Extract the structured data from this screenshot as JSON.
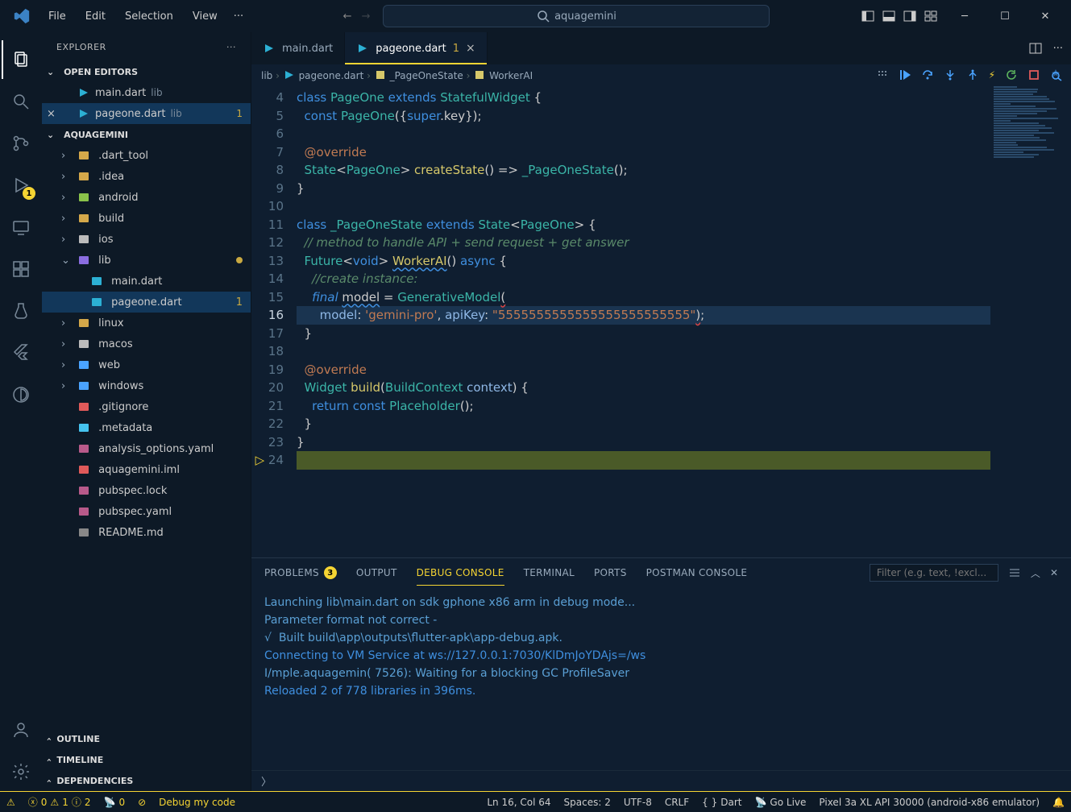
{
  "titlebar": {
    "menu": [
      "File",
      "Edit",
      "Selection",
      "View"
    ],
    "ellipsis": "···",
    "search_label": "aquagemini"
  },
  "activity": {
    "debug_badge": "1"
  },
  "sidebar": {
    "title": "EXPLORER",
    "open_editors_label": "OPEN EDITORS",
    "open_editors": [
      {
        "name": "main.dart",
        "dir": "lib",
        "active": false,
        "badge": ""
      },
      {
        "name": "pageone.dart",
        "dir": "lib",
        "active": true,
        "badge": "1"
      }
    ],
    "project": "AQUAGEMINI",
    "tree": [
      {
        "depth": 0,
        "chev": ">",
        "icon": "folder",
        "label": ".dart_tool"
      },
      {
        "depth": 0,
        "chev": ">",
        "icon": "folder",
        "label": ".idea"
      },
      {
        "depth": 0,
        "chev": ">",
        "icon": "folder-android",
        "label": "android"
      },
      {
        "depth": 0,
        "chev": ">",
        "icon": "folder",
        "label": "build"
      },
      {
        "depth": 0,
        "chev": ">",
        "icon": "folder-ios",
        "label": "ios"
      },
      {
        "depth": 0,
        "chev": "v",
        "icon": "folder-lib",
        "label": "lib",
        "dot": true
      },
      {
        "depth": 1,
        "chev": "",
        "icon": "dart",
        "label": "main.dart"
      },
      {
        "depth": 1,
        "chev": "",
        "icon": "dart",
        "label": "pageone.dart",
        "sel": true,
        "num": "1"
      },
      {
        "depth": 0,
        "chev": ">",
        "icon": "folder-linux",
        "label": "linux"
      },
      {
        "depth": 0,
        "chev": ">",
        "icon": "folder-mac",
        "label": "macos"
      },
      {
        "depth": 0,
        "chev": ">",
        "icon": "folder-web",
        "label": "web"
      },
      {
        "depth": 0,
        "chev": ">",
        "icon": "folder-win",
        "label": "windows"
      },
      {
        "depth": 0,
        "chev": "",
        "icon": "git",
        "label": ".gitignore"
      },
      {
        "depth": 0,
        "chev": "",
        "icon": "flutter",
        "label": ".metadata"
      },
      {
        "depth": 0,
        "chev": "",
        "icon": "yaml",
        "label": "analysis_options.yaml"
      },
      {
        "depth": 0,
        "chev": "",
        "icon": "iml",
        "label": "aquagemini.iml"
      },
      {
        "depth": 0,
        "chev": "",
        "icon": "yaml",
        "label": "pubspec.lock"
      },
      {
        "depth": 0,
        "chev": "",
        "icon": "yaml",
        "label": "pubspec.yaml"
      },
      {
        "depth": 0,
        "chev": "",
        "icon": "md",
        "label": "README.md"
      }
    ],
    "collapsed": [
      "OUTLINE",
      "TIMELINE",
      "DEPENDENCIES"
    ]
  },
  "tabs": [
    {
      "name": "main.dart",
      "active": false,
      "indicator": ""
    },
    {
      "name": "pageone.dart",
      "active": true,
      "indicator": "1"
    }
  ],
  "breadcrumb": [
    "lib",
    "pageone.dart",
    "_PageOneState",
    "WorkerAI"
  ],
  "code": {
    "first_line": 4,
    "current_line": 16,
    "lines": [
      {
        "n": 4,
        "html": "<span class='kw'>class</span> <span class='cls'>PageOne</span> <span class='kw'>extends</span> <span class='cls'>StatefulWidget</span> {"
      },
      {
        "n": 5,
        "html": "  <span class='kw'>const</span> <span class='cls'>PageOne</span>({<span class='kw'>super</span>.key});"
      },
      {
        "n": 6,
        "html": ""
      },
      {
        "n": 7,
        "html": "  <span class='ann'>@override</span>"
      },
      {
        "n": 8,
        "html": "  <span class='cls'>State</span>&lt;<span class='cls'>PageOne</span>&gt; <span class='fn'>createState</span>() =&gt; <span class='cls'>_PageOneState</span>();"
      },
      {
        "n": 9,
        "html": "}"
      },
      {
        "n": 10,
        "html": ""
      },
      {
        "n": 11,
        "html": "<span class='kw'>class</span> <span class='cls'>_PageOneState</span> <span class='kw'>extends</span> <span class='cls'>State</span>&lt;<span class='cls'>PageOne</span>&gt; {"
      },
      {
        "n": 12,
        "html": "  <span class='cmt'>// method to handle API + send request + get answer</span>"
      },
      {
        "n": 13,
        "html": "  <span class='cls'>Future</span>&lt;<span class='kw'>void</span>&gt; <span class='fn wavey'>WorkerAI</span>() <span class='kw'>async</span> {"
      },
      {
        "n": 14,
        "html": "    <span class='cmt'>//create instance:</span>"
      },
      {
        "n": 15,
        "html": "    <span class='kw'><i>final</i></span> <span class='wavey'>model</span> = <span class='cls'>GenerativeModel</span><span class='waveyR'>(</span>"
      },
      {
        "n": 16,
        "html": "      <span class='param'>model</span>: <span class='str'>'gemini-pro'</span>, <span class='param'>apiKey</span>: <span class='str'>\"5555555555555555555555555\"</span><span class='waveyR'>)</span>;"
      },
      {
        "n": 17,
        "html": "  }"
      },
      {
        "n": 18,
        "html": ""
      },
      {
        "n": 19,
        "html": "  <span class='ann'>@override</span>"
      },
      {
        "n": 20,
        "html": "  <span class='cls'>Widget</span> <span class='fn'>build</span>(<span class='cls'>BuildContext</span> <span class='param'>context</span>) {"
      },
      {
        "n": 21,
        "html": "    <span class='kw'>return</span> <span class='kw'>const</span> <span class='cls'>Placeholder</span>();"
      },
      {
        "n": 22,
        "html": "  }"
      },
      {
        "n": 23,
        "html": "}"
      },
      {
        "n": 24,
        "html": "",
        "eof": true
      }
    ]
  },
  "panel": {
    "tabs": {
      "problems": "PROBLEMS",
      "problems_badge": "3",
      "output": "OUTPUT",
      "debug": "DEBUG CONSOLE",
      "terminal": "TERMINAL",
      "ports": "PORTS",
      "postman": "POSTMAN CONSOLE"
    },
    "filter_placeholder": "Filter (e.g. text, !excl...",
    "lines": [
      {
        "cls": "c-def",
        "t": "Launching lib\\main.dart on sdk gphone x86 arm in debug mode..."
      },
      {
        "cls": "c-def",
        "t": "Parameter format not correct -"
      },
      {
        "cls": "c-def",
        "t": "√  Built build\\app\\outputs\\flutter-apk\\app-debug.apk."
      },
      {
        "cls": "c-blue",
        "t": "Connecting to VM Service at ws://127.0.0.1:7030/KlDmJoYDAjs=/ws"
      },
      {
        "cls": "c-def",
        "t": "I/mple.aquagemin( 7526): Waiting for a blocking GC ProfileSaver"
      },
      {
        "cls": "c-blue",
        "t": "Reloaded 2 of 778 libraries in 396ms."
      }
    ]
  },
  "status": {
    "errors": "0",
    "warnings": "1",
    "info": "2",
    "ports": "0",
    "debug": "Debug my code",
    "pos": "Ln 16, Col 64",
    "spaces": "Spaces: 2",
    "enc": "UTF-8",
    "eol": "CRLF",
    "lang": "Dart",
    "golive": "Go Live",
    "device": "Pixel 3a XL API 30000 (android-x86 emulator)"
  }
}
